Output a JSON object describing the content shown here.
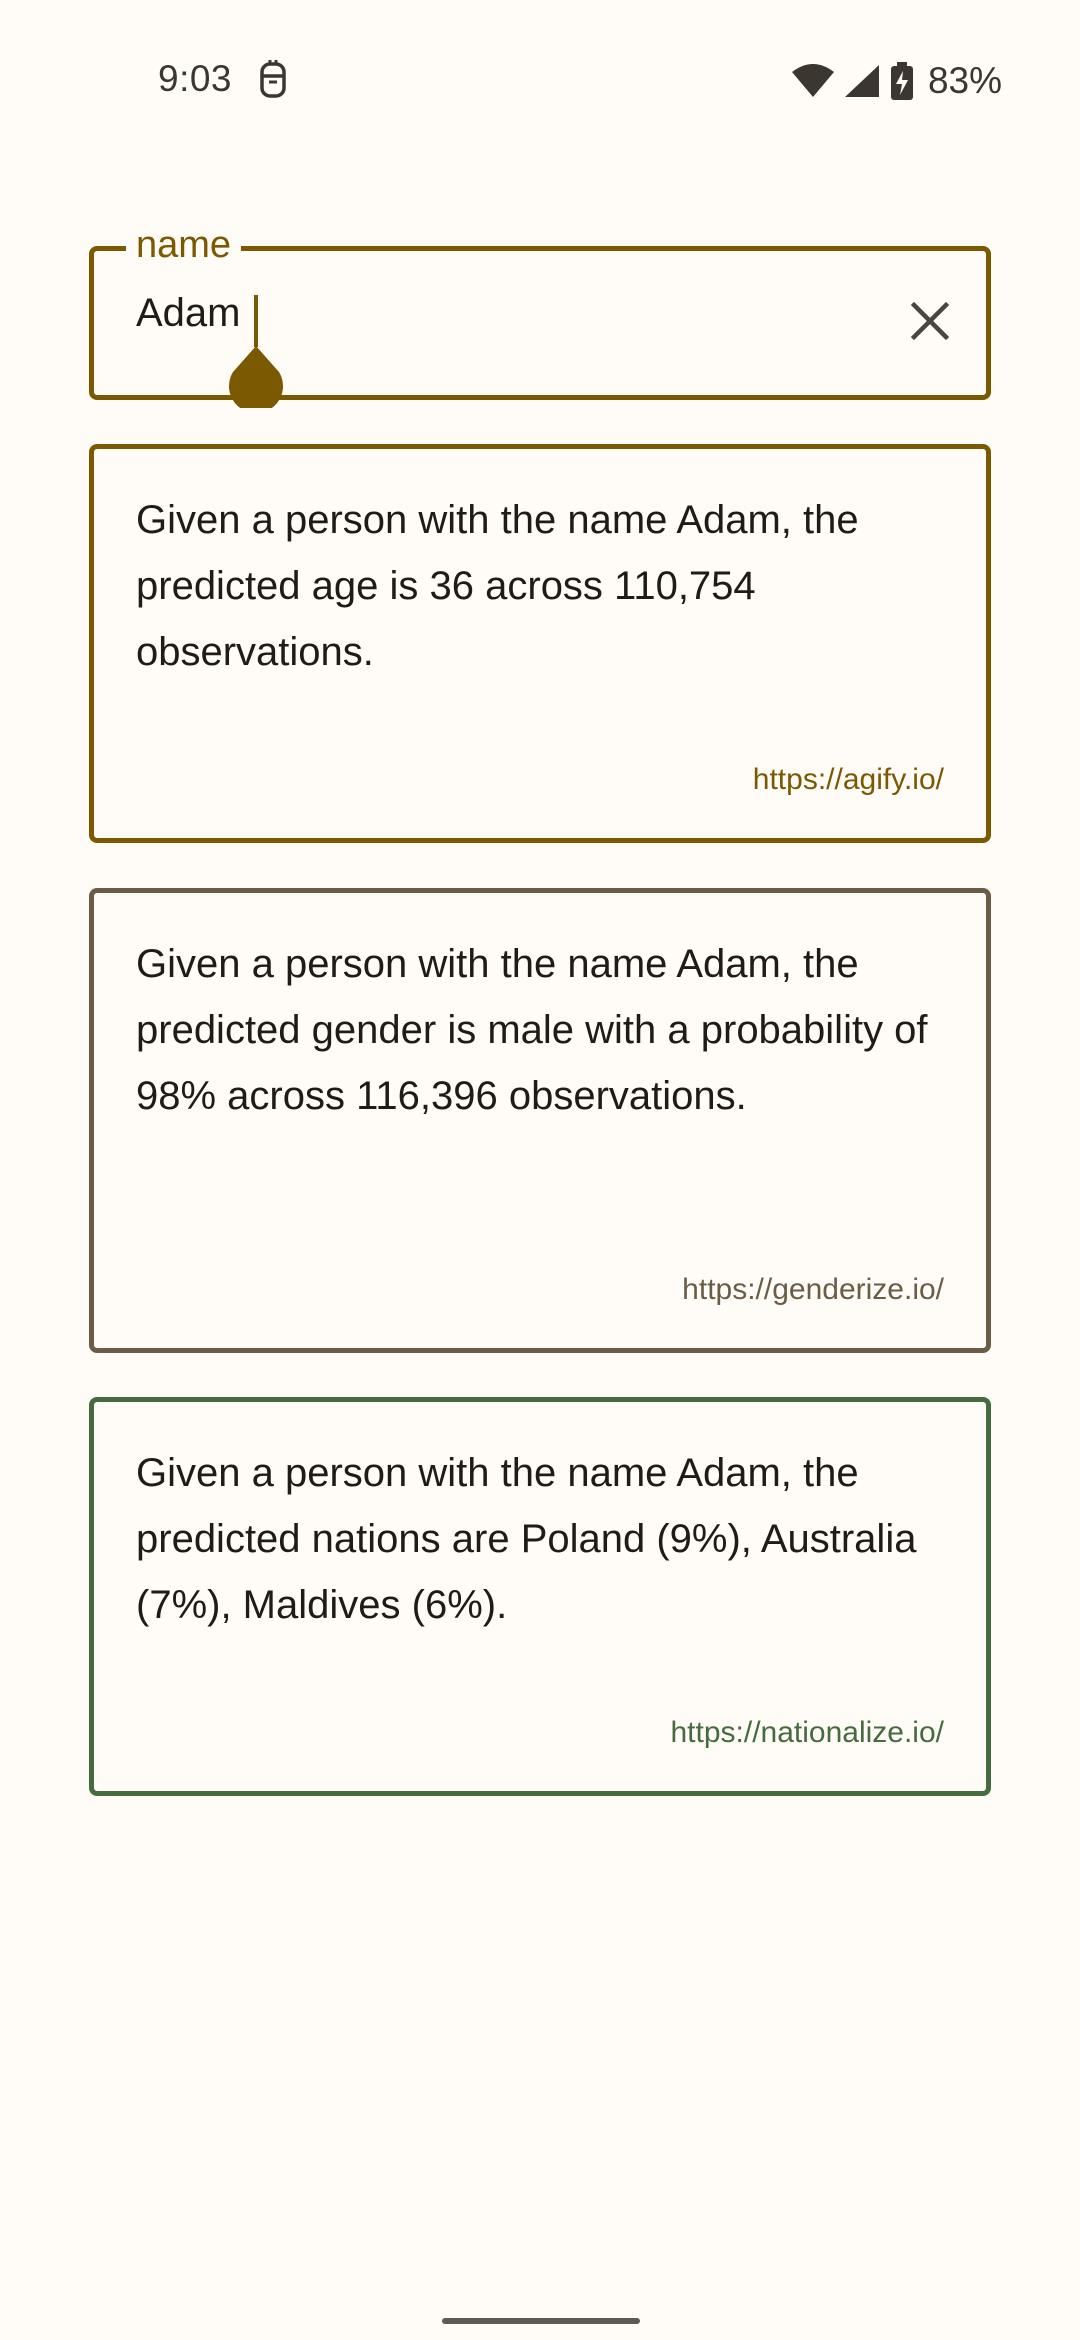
{
  "status_bar": {
    "time": "9:03",
    "battery": "83%",
    "icons": [
      "notification-icon",
      "wifi-icon",
      "signal-icon",
      "battery-charging-icon"
    ]
  },
  "name_field": {
    "label": "name",
    "value": "Adam",
    "clear_icon": "close-icon"
  },
  "cards": {
    "age": {
      "text": "Given a person with the name Adam, the predicted age is 36 across 110,754 observations.",
      "link": "https://agify.io/",
      "color": "#7a5900"
    },
    "gender": {
      "text": "Given a person with the name Adam, the predicted gender is male with a probability of 98% across 116,396 observations.",
      "link": "https://genderize.io/",
      "color": "#6b5c46"
    },
    "nationality": {
      "text": "Given a person with the name Adam, the predicted nations are Poland (9%), Australia (7%), Maldives (6%).",
      "link": "https://nationalize.io/",
      "color": "#466b3f"
    }
  },
  "colors": {
    "background": "#fffbf7",
    "primary": "#7a5900",
    "text": "#1f1b16"
  }
}
